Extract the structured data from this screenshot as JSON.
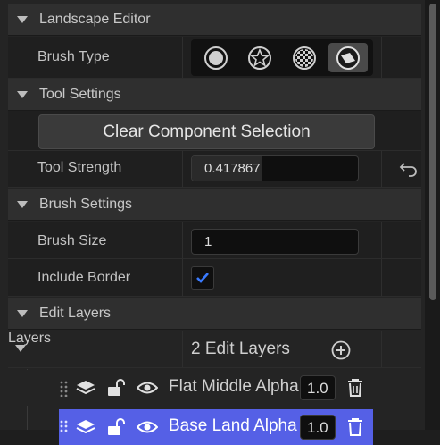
{
  "sections": {
    "landscape_editor": "Landscape Editor",
    "tool_settings": "Tool Settings",
    "brush_settings": "Brush Settings",
    "edit_layers": "Edit Layers"
  },
  "brush_type": {
    "label": "Brush Type",
    "options": [
      "circle-brush-icon",
      "alpha-brush-icon",
      "pattern-brush-icon",
      "component-brush-icon"
    ],
    "selected_index": 3
  },
  "tool_settings": {
    "clear_button": "Clear Component Selection",
    "strength_label": "Tool Strength",
    "strength_value": "0.417867",
    "strength_fraction": 0.417867
  },
  "brush_settings": {
    "size_label": "Brush Size",
    "size_value": "1",
    "include_border_label": "Include Border",
    "include_border_checked": true
  },
  "edit_layers": {
    "layers_label": "Layers",
    "count_text": "2 Edit Layers",
    "items": [
      {
        "name": "Flat Middle Alpha",
        "alpha": "1.0",
        "selected": false
      },
      {
        "name": "Base Land Alpha",
        "alpha": "1.0",
        "selected": true
      }
    ]
  },
  "colors": {
    "accent": "#5560e6",
    "checkmark": "#3a7bff"
  }
}
